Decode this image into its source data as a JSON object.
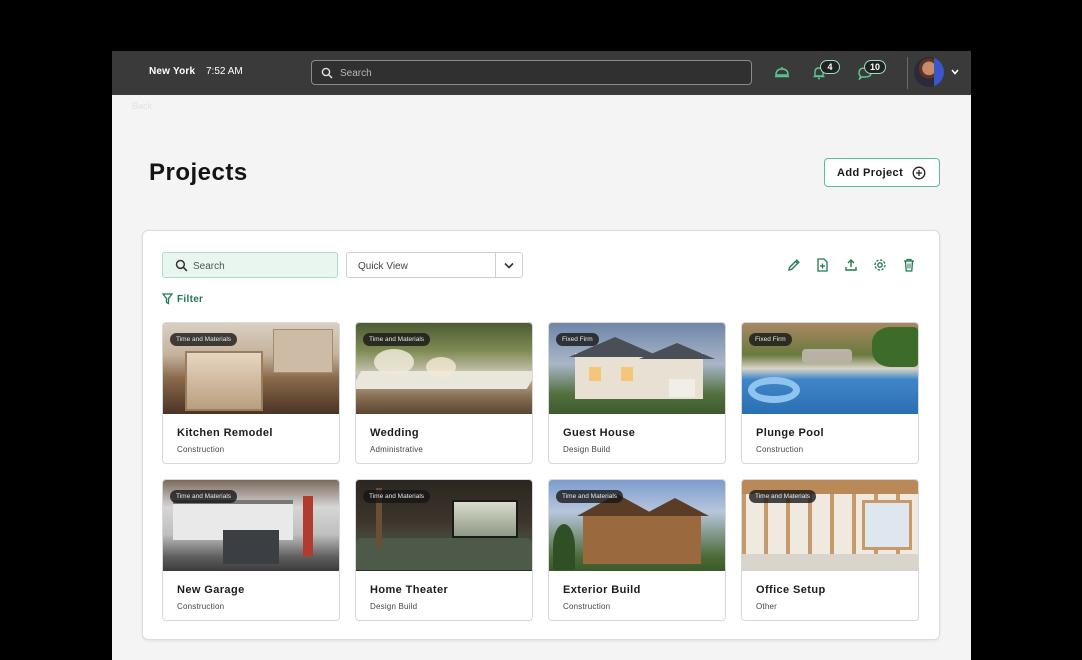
{
  "topbar": {
    "city": "New York",
    "time": "7:52 AM",
    "search_placeholder": "Search",
    "notification_count": "4",
    "message_count": "10"
  },
  "back_label": "Back",
  "page": {
    "title": "Projects",
    "add_button": "Add Project"
  },
  "toolbar": {
    "search_placeholder": "Search",
    "quick_view": "Quick View",
    "filter_label": "Filter"
  },
  "colors": {
    "accent": "#1e7a4f",
    "accent_light": "#e8f6ef",
    "topbar": "#3a3a3a"
  },
  "projects": [
    {
      "name": "Kitchen Remodel",
      "category": "Construction",
      "type": "Time and Materials",
      "image": "kitchen-photo"
    },
    {
      "name": "Wedding",
      "category": "Administrative",
      "type": "Time and Materials",
      "image": "wedding-table-photo"
    },
    {
      "name": "Guest House",
      "category": "Design Build",
      "type": "Fixed Firm",
      "image": "house-photo"
    },
    {
      "name": "Plunge Pool",
      "category": "Construction",
      "type": "Fixed Firm",
      "image": "pool-photo"
    },
    {
      "name": "New Garage",
      "category": "Construction",
      "type": "Time and Materials",
      "image": "garage-photo"
    },
    {
      "name": "Home Theater",
      "category": "Design Build",
      "type": "Time and Materials",
      "image": "theater-photo"
    },
    {
      "name": "Exterior Build",
      "category": "Construction",
      "type": "Time and Materials",
      "image": "exterior-house-photo"
    },
    {
      "name": "Office Setup",
      "category": "Other",
      "type": "Time and Materials",
      "image": "framing-photo"
    }
  ]
}
